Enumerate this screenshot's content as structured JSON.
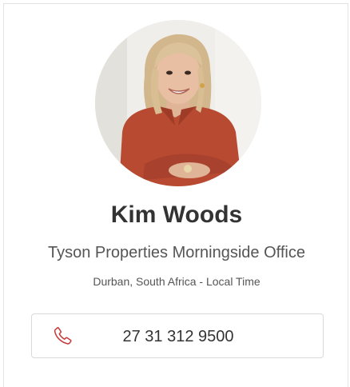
{
  "agent": {
    "name": "Kim Woods",
    "office": "Tyson Properties Morningside Office",
    "location": "Durban, South Africa - Local Time",
    "phone": "27 31 312 9500"
  },
  "icons": {
    "phone": "phone-icon"
  },
  "colors": {
    "accent": "#c8393a",
    "text": "#333333",
    "muted": "#555555",
    "border": "#d9d9d9"
  }
}
